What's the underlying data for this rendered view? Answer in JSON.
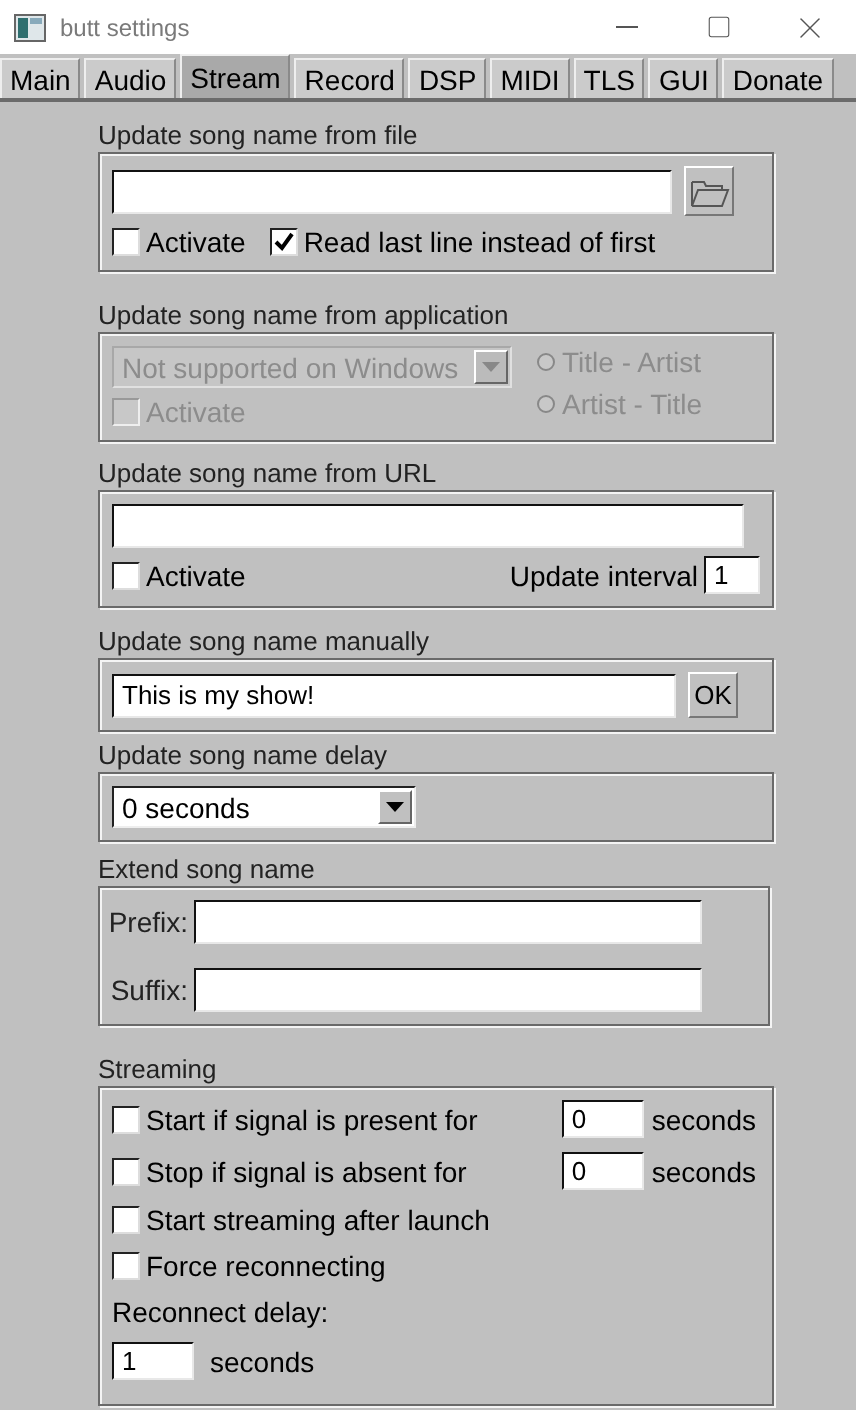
{
  "window": {
    "title": "butt settings"
  },
  "tabs": [
    {
      "label": "Main",
      "selected": false
    },
    {
      "label": "Audio",
      "selected": false
    },
    {
      "label": "Stream",
      "selected": true
    },
    {
      "label": "Record",
      "selected": false
    },
    {
      "label": "DSP",
      "selected": false
    },
    {
      "label": "MIDI",
      "selected": false
    },
    {
      "label": "TLS",
      "selected": false
    },
    {
      "label": "GUI",
      "selected": false
    },
    {
      "label": "Donate",
      "selected": false
    }
  ],
  "file_group": {
    "title": "Update song name from file",
    "checkboxes": [
      {
        "label": "Activate",
        "checked": false
      },
      {
        "label": "Read last line instead of first",
        "checked": true
      }
    ]
  },
  "app_group": {
    "title": "Update song name from application",
    "disabled": true,
    "dropdown": "Not supported on Windows",
    "activate": {
      "label": "Activate",
      "checked": false
    },
    "radios": [
      {
        "label": "Title - Artist",
        "selected": false
      },
      {
        "label": "Artist - Title",
        "selected": false
      }
    ]
  },
  "url_group": {
    "title": "Update song name from URL",
    "activate": {
      "label": "Activate",
      "checked": false
    },
    "interval_label": "Update interval",
    "interval_value": "1"
  },
  "manual_group": {
    "title": "Update song name manually",
    "value": "This is my show!",
    "button": "OK"
  },
  "delay_group": {
    "title": "Update song name delay",
    "value": "0 seconds"
  },
  "extend_group": {
    "title": "Extend song name",
    "fields": [
      {
        "label": "Prefix:"
      },
      {
        "label": "Suffix:"
      }
    ]
  },
  "streaming_group": {
    "title": "Streaming",
    "options": [
      {
        "kind": "timed",
        "label": "Start if signal is present for",
        "checked": false,
        "value": "0",
        "unit": "seconds"
      },
      {
        "kind": "timed",
        "label": "Stop if signal is absent for",
        "checked": false,
        "value": "0",
        "unit": "seconds"
      },
      {
        "kind": "plain",
        "label": "Start streaming after launch",
        "checked": false
      },
      {
        "kind": "plain",
        "label": "Force reconnecting",
        "checked": false
      }
    ],
    "reconnect": {
      "label": "Reconnect delay:",
      "value": "1",
      "unit": "seconds"
    }
  }
}
